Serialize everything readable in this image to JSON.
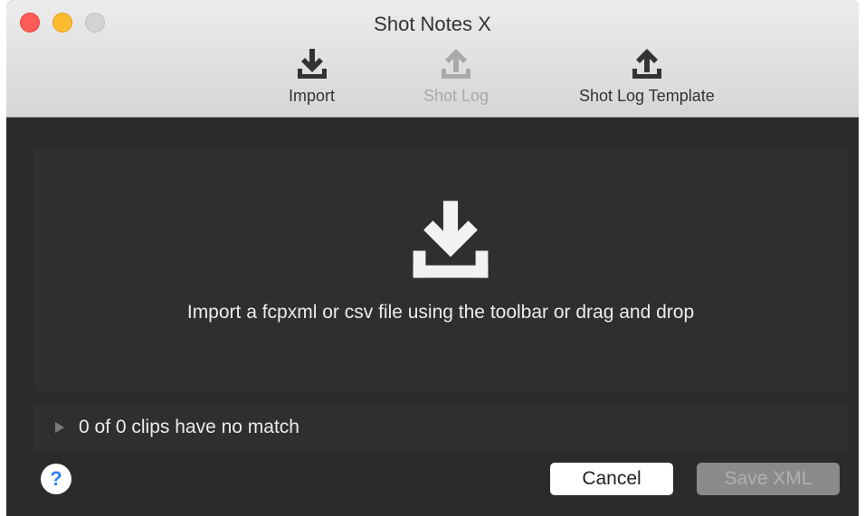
{
  "window": {
    "title": "Shot Notes X"
  },
  "toolbar": {
    "import_label": "Import",
    "shotlog_label": "Shot Log",
    "template_label": "Shot Log Template"
  },
  "icons": {
    "import": "download-icon",
    "shotlog": "upload-icon",
    "template": "upload-icon",
    "drop": "download-icon",
    "help": "question-mark-icon"
  },
  "drop_zone": {
    "message": "Import a fcpxml or csv file using the toolbar or drag and drop"
  },
  "status": {
    "no_match_text": "0 of 0 clips have no match"
  },
  "help": {
    "glyph": "?"
  },
  "buttons": {
    "cancel": "Cancel",
    "save": "Save XML"
  },
  "colors": {
    "close": "#fc5b57",
    "minimize": "#fdbc2f",
    "zoom": "#d3d3d3",
    "help_accent": "#2f7ff0"
  }
}
